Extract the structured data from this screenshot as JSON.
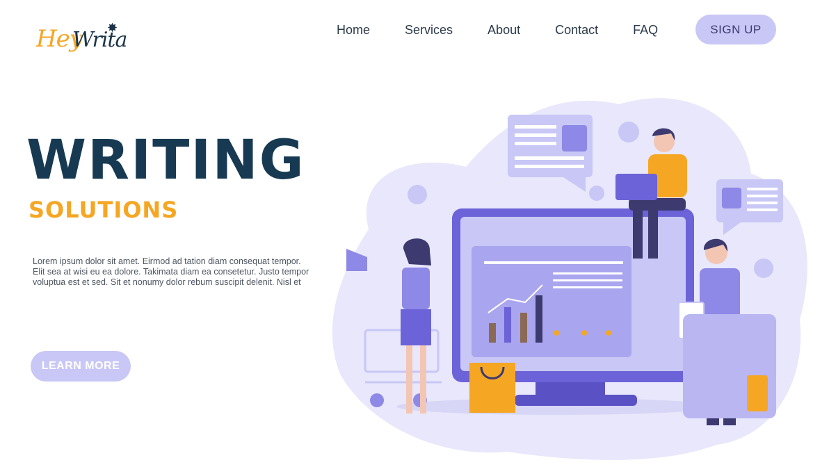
{
  "brand": {
    "logo_part1": "Hey",
    "logo_part2": "Writa"
  },
  "nav": {
    "items": [
      {
        "label": "Home"
      },
      {
        "label": "Services"
      },
      {
        "label": "About"
      },
      {
        "label": "Contact"
      },
      {
        "label": "FAQ"
      }
    ],
    "signup_label": "SIGN UP"
  },
  "hero": {
    "title": "WRITING",
    "subtitle": "SOLUTIONS",
    "body": "Lorem ipsum dolor sit amet. Eirmod ad tation diam consequat tempor. Elit sea at wisi eu ea dolore. Takimata diam ea consetetur. Justo tempor voluptua est et sed. Sit et nonumy dolor rebum suscipit delenit. Nisl et",
    "cta_label": "LEARN MORE"
  },
  "colors": {
    "accent": "#f5a623",
    "navy": "#173a52",
    "lavender": "#c8c7f5",
    "purple": "#6c63d8"
  }
}
